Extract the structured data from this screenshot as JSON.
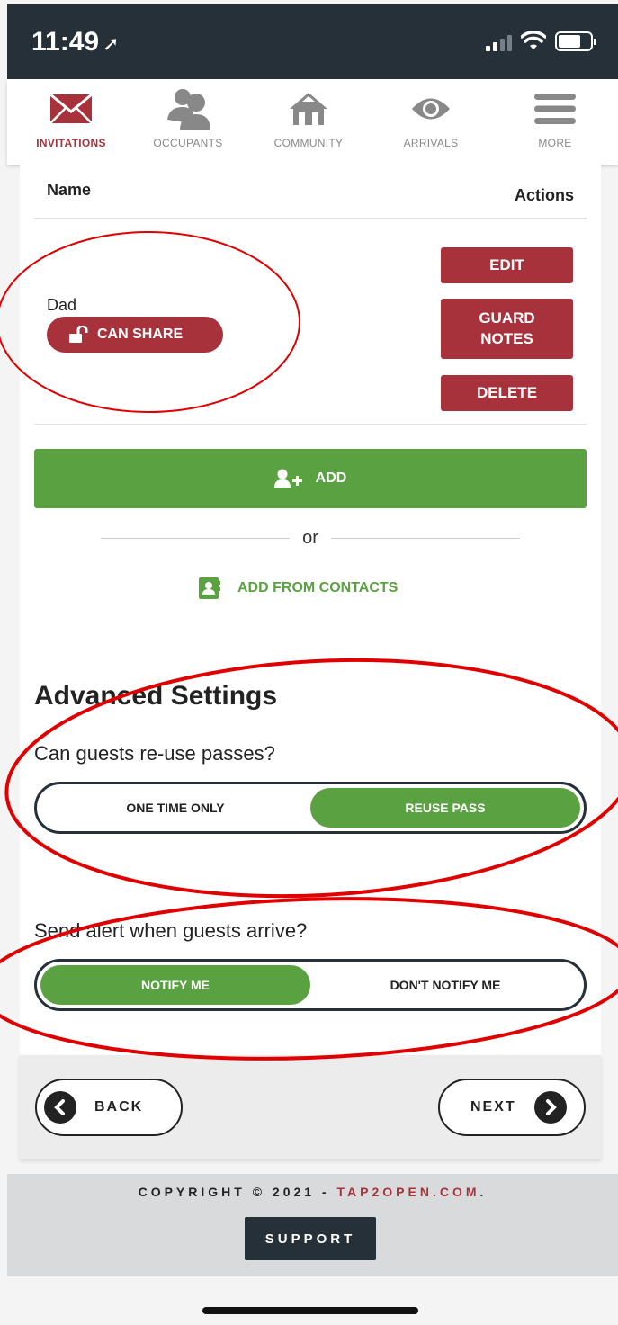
{
  "status_bar": {
    "time": "11:49",
    "location_arrow": "➚"
  },
  "nav": {
    "items": [
      {
        "label": "INVITATIONS",
        "icon": "envelope-icon",
        "active": true
      },
      {
        "label": "OCCUPANTS",
        "icon": "people-icon",
        "active": false
      },
      {
        "label": "COMMUNITY",
        "icon": "houses-icon",
        "active": false
      },
      {
        "label": "ARRIVALS",
        "icon": "eye-icon",
        "active": false
      },
      {
        "label": "MORE",
        "icon": "hamburger-icon",
        "active": false
      }
    ]
  },
  "table": {
    "header_name": "Name",
    "header_actions": "Actions",
    "rows": [
      {
        "name": "Dad",
        "badge": "CAN SHARE",
        "actions": [
          "EDIT",
          "GUARD NOTES",
          "DELETE"
        ]
      }
    ]
  },
  "add_button": "ADD",
  "or_text": "or",
  "add_from_contacts": "ADD FROM CONTACTS",
  "advanced": {
    "title": "Advanced Settings",
    "reuse_question": "Can guests re-use passes?",
    "reuse_options": [
      "ONE TIME ONLY",
      "REUSE PASS"
    ],
    "reuse_selected": "REUSE PASS",
    "alert_question": "Send alert when guests arrive?",
    "alert_options": [
      "NOTIFY ME",
      "DON'T NOTIFY ME"
    ],
    "alert_selected": "NOTIFY ME"
  },
  "footer_nav": {
    "back": "BACK",
    "next": "NEXT"
  },
  "footer": {
    "copyright_prefix": "COPYRIGHT © 2021 - ",
    "brand": "TAP2OPEN.COM",
    "suffix": ".",
    "support": "SUPPORT"
  },
  "colors": {
    "brand_red": "#a8323c",
    "green": "#5aa141",
    "dark": "#263038",
    "annotation_red": "#e00000"
  }
}
